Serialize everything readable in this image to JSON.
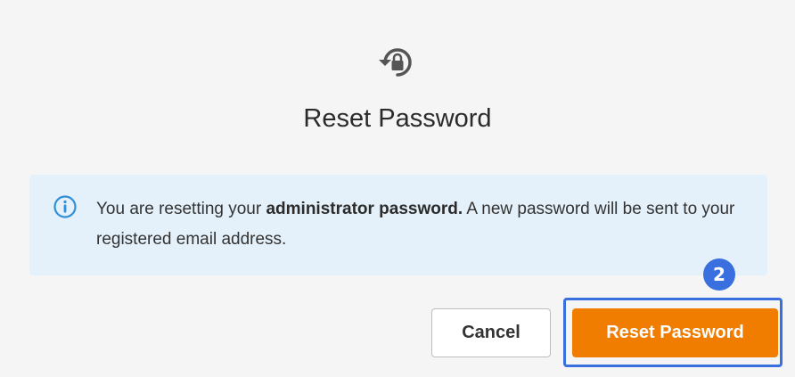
{
  "dialog": {
    "header_icon": "reset-lock-icon",
    "title": "Reset Password"
  },
  "info": {
    "icon": "info-icon",
    "text_before": "You are resetting your ",
    "text_bold": "administrator password.",
    "text_after": " A new password will be sent to your registered email address."
  },
  "buttons": {
    "cancel_label": "Cancel",
    "reset_label": "Reset Password"
  },
  "annotation": {
    "step_number": "2"
  },
  "colors": {
    "accent": "#f07c00",
    "highlight": "#3a6fe0",
    "info_bg": "#e4f1fa",
    "info_icon": "#2f8fd8"
  }
}
